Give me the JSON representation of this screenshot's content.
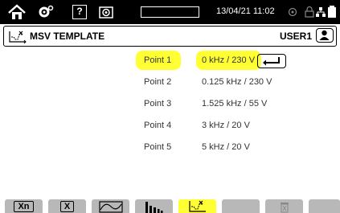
{
  "topbar": {
    "datetime": "13/04/21 11:02",
    "help_icon_text": "?",
    "colors": {
      "background": "#000000",
      "foreground": "#ffffff"
    }
  },
  "header": {
    "title": "MSV TEMPLATE",
    "user": "USER1"
  },
  "points": [
    {
      "label": "Point 1",
      "value": "0 kHz / 230 V",
      "selected": true
    },
    {
      "label": "Point 2",
      "value": "0.125 kHz / 230 V",
      "selected": false
    },
    {
      "label": "Point 3",
      "value": "1.525 kHz / 55 V",
      "selected": false
    },
    {
      "label": "Point 4",
      "value": "3 kHz / 20 V",
      "selected": false
    },
    {
      "label": "Point 5",
      "value": "5 kHz / 20 V",
      "selected": false
    }
  ],
  "function_keys": [
    {
      "name": "xn-key",
      "label": "Xn"
    },
    {
      "name": "x-key",
      "label": "X"
    },
    {
      "name": "waveform-key",
      "label": ""
    },
    {
      "name": "harmonics-key",
      "label": ""
    },
    {
      "name": "msv-key",
      "label": "",
      "selected": true
    },
    {
      "name": "blank-key-1",
      "label": ""
    },
    {
      "name": "delete-key",
      "label": ""
    },
    {
      "name": "blank-key-2",
      "label": ""
    }
  ],
  "colors": {
    "highlight": "#ffff33",
    "key_gray": "#b8b8b8"
  }
}
